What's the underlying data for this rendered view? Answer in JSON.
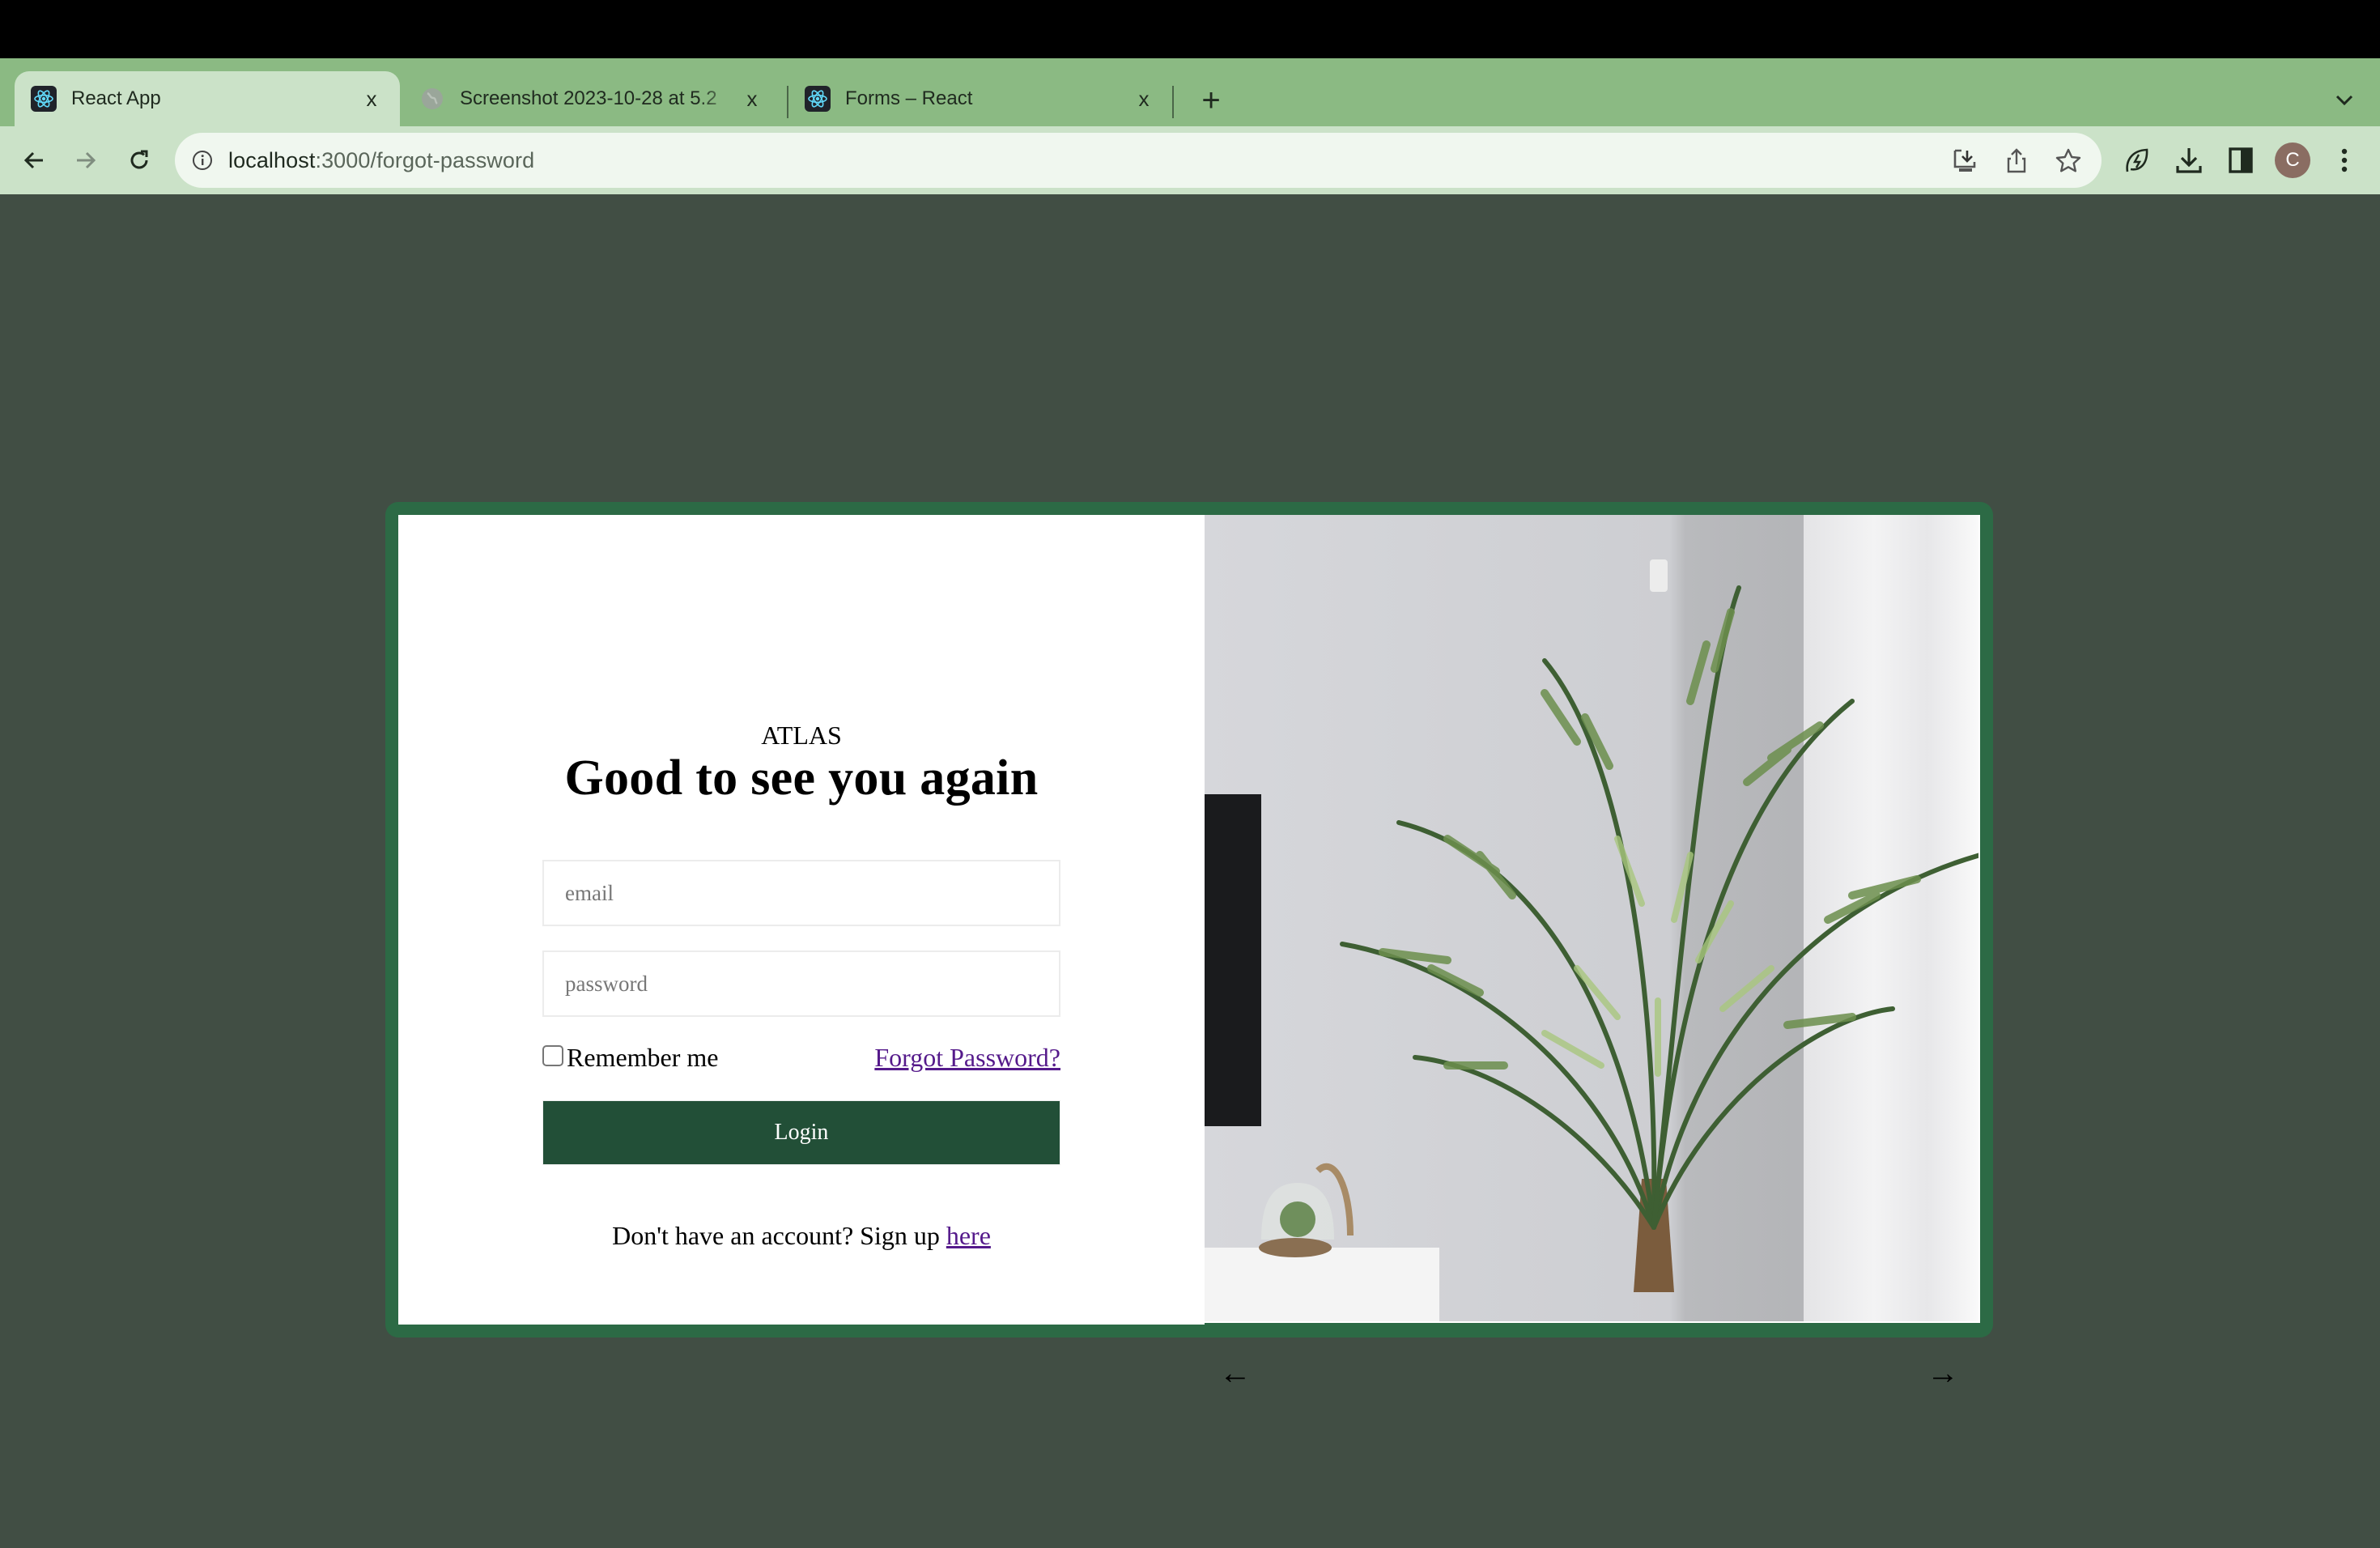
{
  "browser": {
    "tabs": [
      {
        "title": "React App",
        "icon": "react-icon",
        "active": true
      },
      {
        "title": "Screenshot 2023-10-28 at 5.2",
        "icon": "globe-icon",
        "active": false
      },
      {
        "title": "Forms – React",
        "icon": "react-icon",
        "active": false
      }
    ],
    "close_glyph": "x",
    "new_tab_glyph": "+",
    "url_host": "localhost",
    "url_path": ":3000/forgot-password",
    "avatar_initial": "C"
  },
  "colors": {
    "page_bg": "#414e44",
    "card_frame": "#2c6a45",
    "button_bg": "#224f37",
    "link": "#551a8b",
    "tabstrip": "#8bba83",
    "toolbar": "#cbe2c8"
  },
  "page": {
    "brand": "ATLAS",
    "headline": "Good to see you again",
    "email_placeholder": "email",
    "password_placeholder": "password",
    "remember_label": "Remember me",
    "remember_checked": false,
    "forgot_link": "Forgot Password?",
    "login_button": "Login",
    "signup_text": "Don't have an account? Sign up ",
    "signup_link": "here",
    "carousel_prev": "←",
    "carousel_next": "→"
  }
}
